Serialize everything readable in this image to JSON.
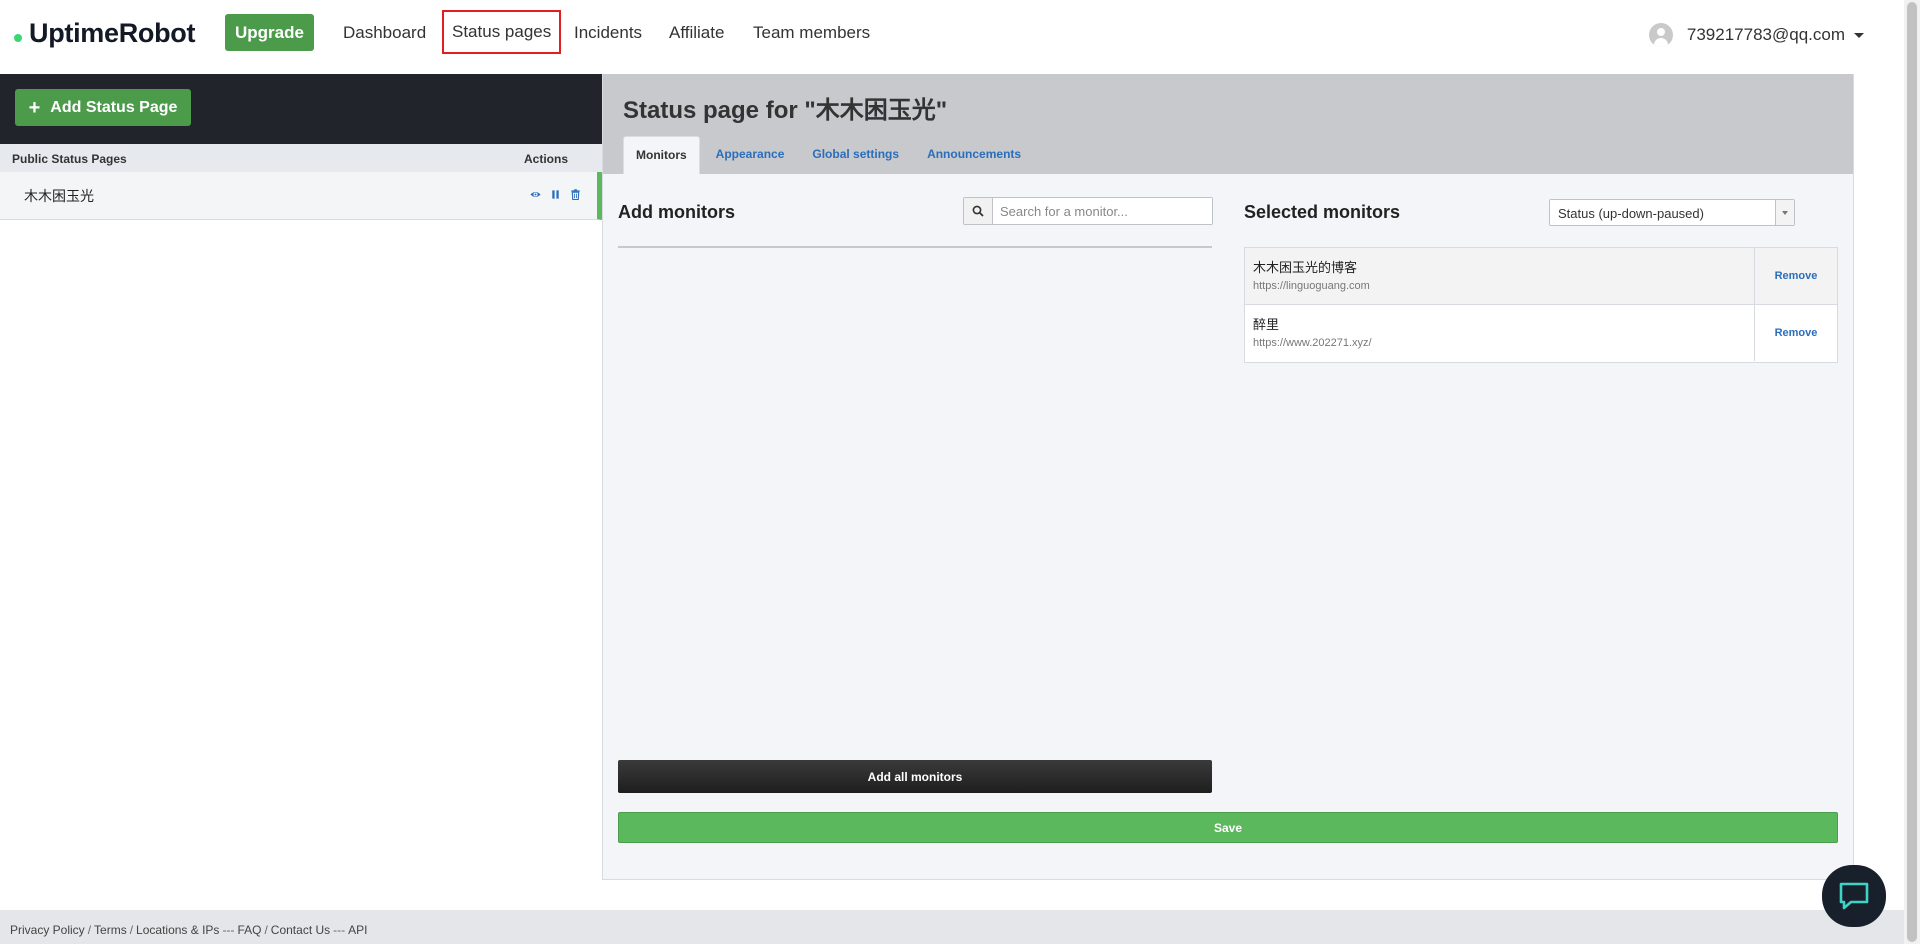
{
  "brand": {
    "name": "UptimeRobot",
    "dot_color": "#3bd671"
  },
  "nav": {
    "upgrade_label": "Upgrade",
    "links": [
      "Dashboard",
      "Status pages",
      "Incidents",
      "Affiliate",
      "Team members"
    ],
    "active_link": "Status pages",
    "account_email": "739217783@qq.com"
  },
  "sidebar": {
    "add_button_label": "Add Status Page",
    "table_headers": {
      "name": "Public Status Pages",
      "actions": "Actions"
    },
    "pages": [
      {
        "name": "木木困玉光",
        "actions": [
          "eye-icon",
          "pause-icon",
          "trash-icon"
        ]
      }
    ]
  },
  "main": {
    "title": "Status page for \"木木困玉光\"",
    "tabs": [
      "Monitors",
      "Appearance",
      "Global settings",
      "Announcements"
    ],
    "active_tab": "Monitors",
    "add_monitors": {
      "title": "Add monitors",
      "search_placeholder": "Search for a monitor...",
      "add_all_label": "Add all monitors"
    },
    "selected_monitors": {
      "title": "Selected monitors",
      "sort_value": "Status (up-down-paused)",
      "remove_label": "Remove",
      "items": [
        {
          "name": "木木困玉光的博客",
          "url": "https://linguoguang.com"
        },
        {
          "name": "醉里",
          "url": "https://www.202271.xyz/"
        }
      ]
    },
    "save_label": "Save"
  },
  "footer": {
    "links": [
      "Privacy Policy",
      "Terms",
      "Locations & IPs",
      "FAQ",
      "Contact Us",
      "API"
    ],
    "separators": [
      "/",
      "/",
      "---",
      "/",
      "---"
    ]
  },
  "colors": {
    "accent_green": "#4c9b4b",
    "save_green": "#5cb85c",
    "link_blue": "#2a6ebb",
    "sidebar_dark": "#21252b",
    "highlight_red": "#e02020"
  }
}
